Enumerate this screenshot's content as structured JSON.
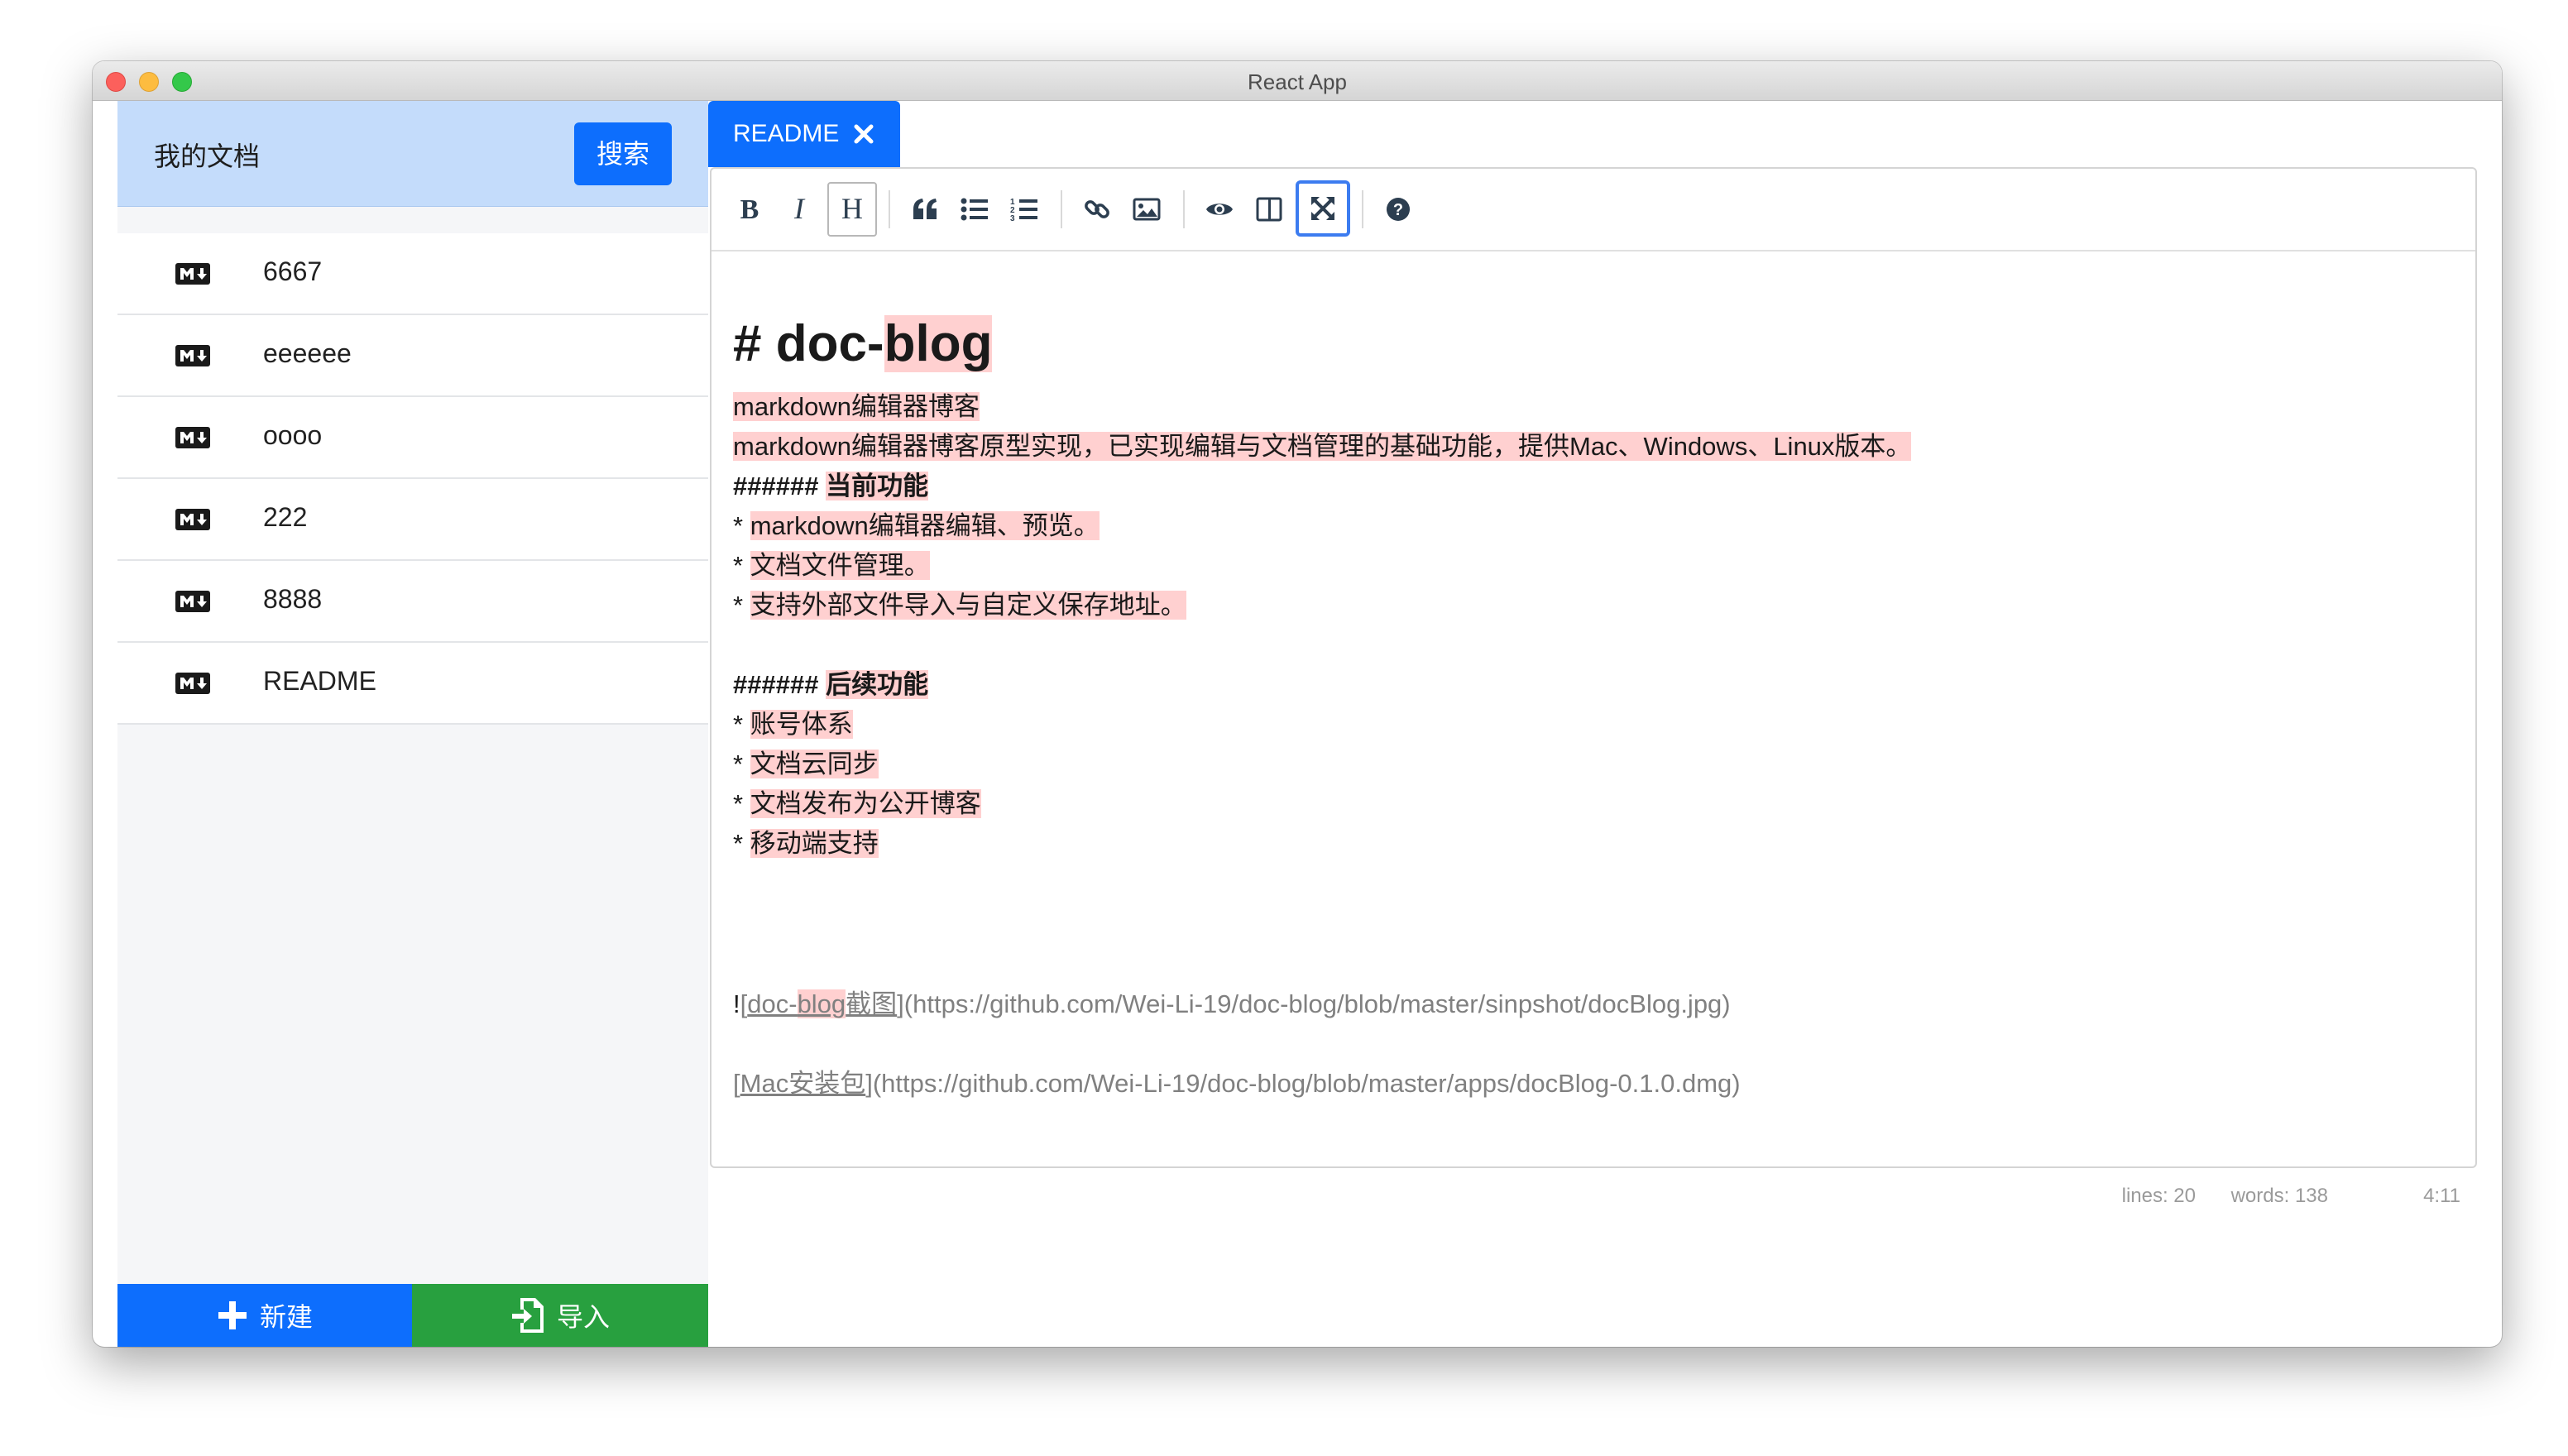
{
  "window": {
    "title": "React App"
  },
  "sidebar": {
    "title": "我的文档",
    "search_label": "搜索",
    "files": [
      {
        "name": "6667"
      },
      {
        "name": "eeeeee"
      },
      {
        "name": "oooo"
      },
      {
        "name": "222"
      },
      {
        "name": "8888"
      },
      {
        "name": "README"
      }
    ],
    "new_label": "新建",
    "import_label": "导入"
  },
  "tabs": [
    {
      "label": "README"
    }
  ],
  "toolbar": {
    "icons": [
      "bold-icon",
      "italic-icon",
      "heading-icon",
      "quote-icon",
      "unordered-list-icon",
      "ordered-list-icon",
      "link-icon",
      "image-icon",
      "preview-icon",
      "side-by-side-icon",
      "fullscreen-icon",
      "guide-icon"
    ]
  },
  "content": {
    "heading_prefix": "# doc-",
    "heading_suffix": "blog",
    "line1": "markdown编辑器博客",
    "line2": "markdown编辑器博客原型实现，已实现编辑与文档管理的基础功能，提供Mac、Windows、Linux版本。",
    "h6_current_prefix": "######",
    "h6_current_text": "当前功能",
    "current_items": [
      "markdown编辑器编辑、预览。",
      "文档文件管理。",
      "支持外部文件导入与自定义保存地址。"
    ],
    "h6_future_prefix": "######",
    "h6_future_text": "后续功能",
    "future_items": [
      "账号体系",
      "文档云同步",
      "文档发布为公开博客",
      "移动端支持"
    ],
    "bullet": "*",
    "image_link_bang": "!",
    "image_link_text_a": "doc-",
    "image_link_text_b": "blog",
    "image_link_text_c": "截图",
    "image_link_url": "(https://github.com/Wei-Li-19/doc-blog/blob/master/sinpshot/docBlog.jpg)",
    "mac_link_text": "Mac安装包",
    "mac_link_url": "(https://github.com/Wei-Li-19/doc-blog/blob/master/apps/docBlog-0.1.0.dmg)"
  },
  "status": {
    "lines": "lines: 20",
    "words": "words: 138",
    "cursor": "4:11"
  },
  "colors": {
    "primary": "#0d6efd",
    "success": "#28a03f",
    "search_bg": "#c4dcfb",
    "highlight": "#ffd0d0"
  }
}
